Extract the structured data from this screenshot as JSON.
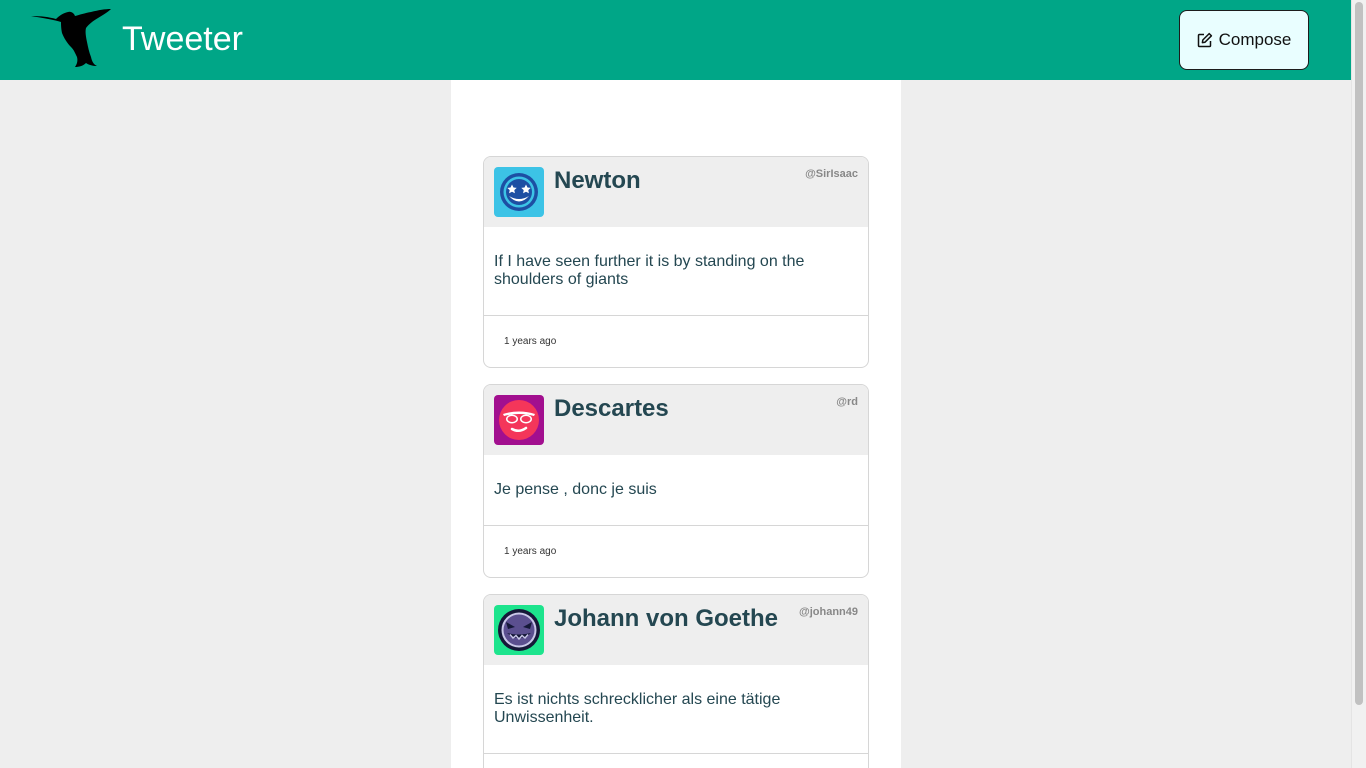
{
  "nav": {
    "title": "Tweeter",
    "compose_label": "Compose",
    "logo_icon": "hummingbird-logo",
    "compose_icon": "edit-icon",
    "background": "#00a687",
    "compose_background": "#e9feff"
  },
  "tweets": [
    {
      "name": "Newton",
      "handle": "@SirIsaac",
      "text": "If I have seen further it is by standing on the shoulders of giants",
      "time": "1 years ago",
      "avatar_icon": "star-eyes-smiley-icon",
      "avatar_color": "#3cc3e6"
    },
    {
      "name": "Descartes",
      "handle": "@rd",
      "text": "Je pense , donc je suis",
      "time": "1 years ago",
      "avatar_icon": "sunglasses-face-icon",
      "avatar_color": "#a20f8f"
    },
    {
      "name": "Johann von Goethe",
      "handle": "@johann49",
      "text": "Es ist nichts schrecklicher als eine tätige Unwissenheit.",
      "time": "",
      "avatar_icon": "grinning-devil-face-icon",
      "avatar_color": "#1de48d"
    }
  ],
  "colors": {
    "page_background": "#eeeeee",
    "text": "#244751",
    "tweet_header": "#eeeeee"
  }
}
